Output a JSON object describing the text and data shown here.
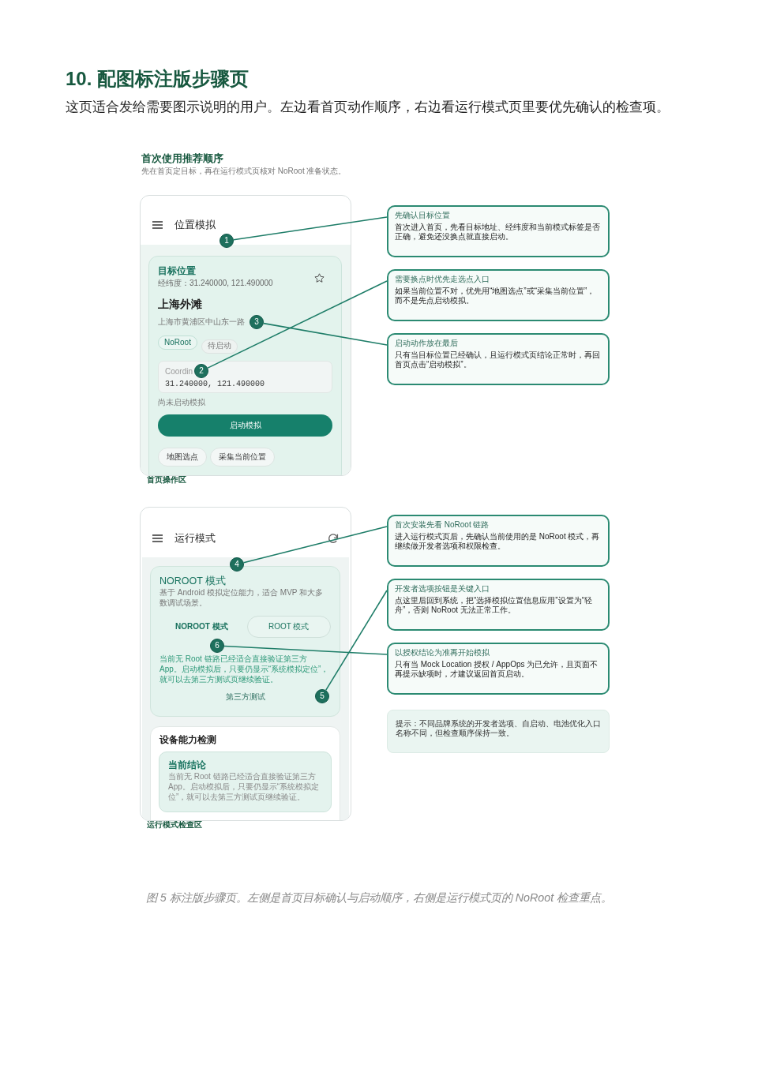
{
  "section": {
    "title": "10. 配图标注版步骤页",
    "intro": "这页适合发给需要图示说明的用户。左边看首页动作顺序，右边看运行模式页里要优先确认的检查项。"
  },
  "figure": {
    "title": "首次使用推荐顺序",
    "subtitle": "先在首页定目标，再在运行模式页核对 NoRoot 准备状态。",
    "panels": [
      {
        "kind": "home",
        "screen": {
          "title": "位置模拟",
          "target": {
            "heading": "目标位置",
            "coordinates": "经纬度：31.240000, 121.490000",
            "favorite": false,
            "name": "上海外滩",
            "address": "上海市黄浦区中山东一路",
            "chips": [
              {
                "label": "NoRoot",
                "kind": "mode"
              },
              {
                "label": "待启动",
                "kind": "status"
              }
            ],
            "field": {
              "label": "Coordin",
              "value": "31.240000, 121.490000"
            },
            "status": "尚未启动模拟",
            "primary_button": "启动模拟",
            "buttons": [
              "地图选点",
              "采集当前位置"
            ]
          }
        },
        "caption": "首页操作区",
        "callouts": [
          {
            "marker": "1",
            "title": "先确认目标位置",
            "text": "首次进入首页，先看目标地址、经纬度和当前模式标签是否正确，避免还没换点就直接启动。"
          },
          {
            "marker": "2",
            "title": "需要换点时优先走选点入口",
            "text": "如果当前位置不对，优先用“地图选点”或“采集当前位置”，而不是先点启动模拟。"
          },
          {
            "marker": "3",
            "title": "启动动作放在最后",
            "text": "只有当目标位置已经确认，且运行模式页结论正常时，再回首页点击“启动模拟”。"
          }
        ]
      },
      {
        "kind": "mode",
        "screen": {
          "title": "运行模式",
          "mode_card": {
            "title": "NOROOT 模式",
            "description": "基于 Android 模拟定位能力，适合 MVP 和大多数调试场景。",
            "modes": [
              {
                "label": "NOROOT 模式",
                "selected": true
              },
              {
                "label": "ROOT 模式",
                "selected": false
              }
            ],
            "notice": "当前无 Root 链路已经适合直接验证第三方 App。启动模拟后，只要仍显示“系统模拟定位”，就可以去第三方测试页继续验证。",
            "link": "第三方测试"
          },
          "check_card": {
            "title": "设备能力检测",
            "conclusion": {
              "title": "当前结论",
              "text": "当前无 Root 链路已经适合直接验证第三方 App。启动模拟后，只要仍显示“系统模拟定位”，就可以去第三方测试页继续验证。"
            }
          }
        },
        "caption": "运行模式检查区",
        "callouts": [
          {
            "marker": "4",
            "title": "首次安装先看 NoRoot 链路",
            "text": "进入运行模式页后，先确认当前使用的是 NoRoot 模式，再继续做开发者选项和权限检查。"
          },
          {
            "marker": "5",
            "title": "开发者选项按钮是关键入口",
            "text": "点这里后回到系统，把“选择模拟位置信息应用”设置为“轻舟”，否则 NoRoot 无法正常工作。"
          },
          {
            "marker": "6",
            "title": "以授权结论为准再开始模拟",
            "text": "只有当 Mock Location 授权 / AppOps 为已允许，且页面不再提示缺项时，才建议返回首页启动。"
          }
        ],
        "tip": "提示：不同品牌系统的开发者选项、自启动、电池优化入口名称不同，但检查顺序保持一致。"
      }
    ]
  },
  "caption": "图 5 标注版步骤页。左侧是首页目标确认与启动顺序，右侧是运行模式页的 NoRoot 检查重点。"
}
